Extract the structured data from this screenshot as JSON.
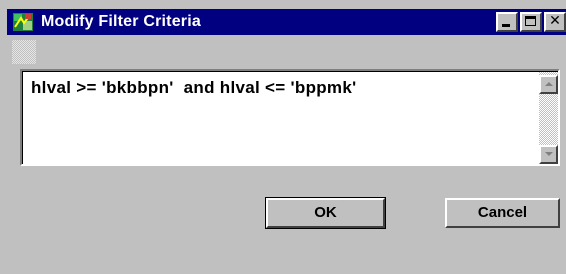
{
  "window": {
    "title": "Modify Filter Criteria",
    "app_icon": "filter-app-icon",
    "controls": {
      "minimize_icon": "minimize-icon",
      "maximize_icon": "maximize-icon",
      "close_glyph": "✕"
    }
  },
  "criteria": {
    "text": "hlval >= 'bkbbpn'  and hlval <= 'bppmk'"
  },
  "buttons": {
    "ok_label": "OK",
    "cancel_label": "Cancel"
  },
  "colors": {
    "titlebar": "#000080",
    "face": "#c0c0c0"
  }
}
